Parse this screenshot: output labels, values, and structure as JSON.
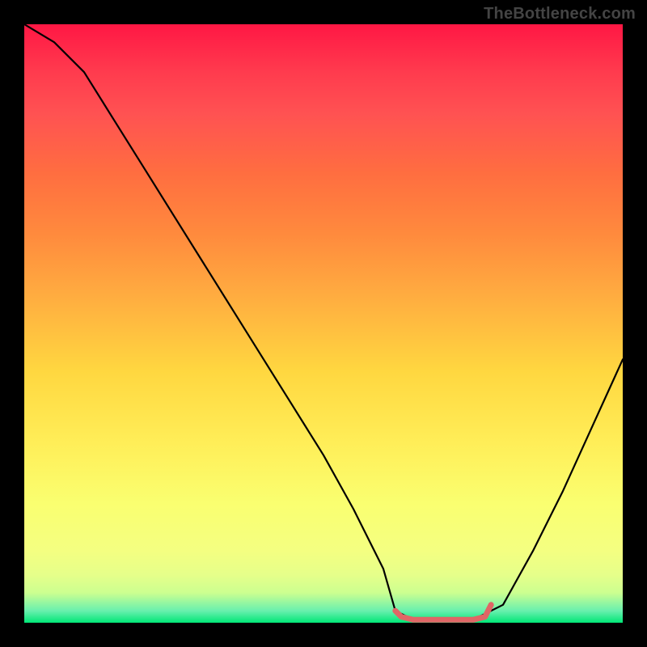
{
  "watermark": "TheBottleneck.com",
  "colors": {
    "curve_stroke": "#000000",
    "optimal_stroke": "#e06666",
    "background_black": "#000000"
  },
  "chart_data": {
    "type": "line",
    "title": "",
    "xlabel": "",
    "ylabel": "",
    "xlim": [
      0,
      100
    ],
    "ylim": [
      0,
      100
    ],
    "grid": false,
    "series": [
      {
        "name": "bottleneck-curve",
        "x": [
          0,
          5,
          10,
          15,
          20,
          25,
          30,
          35,
          40,
          45,
          50,
          55,
          60,
          62,
          65,
          70,
          75,
          80,
          85,
          90,
          95,
          100
        ],
        "values": [
          100,
          97,
          92,
          84,
          76,
          68,
          60,
          52,
          44,
          36,
          28,
          19,
          9,
          2,
          0.5,
          0.5,
          0.5,
          3,
          12,
          22,
          33,
          44
        ]
      },
      {
        "name": "optimal-range",
        "x": [
          62,
          63,
          65,
          70,
          75,
          77,
          78
        ],
        "values": [
          2,
          1,
          0.5,
          0.5,
          0.5,
          1,
          3
        ]
      }
    ],
    "annotations": []
  }
}
